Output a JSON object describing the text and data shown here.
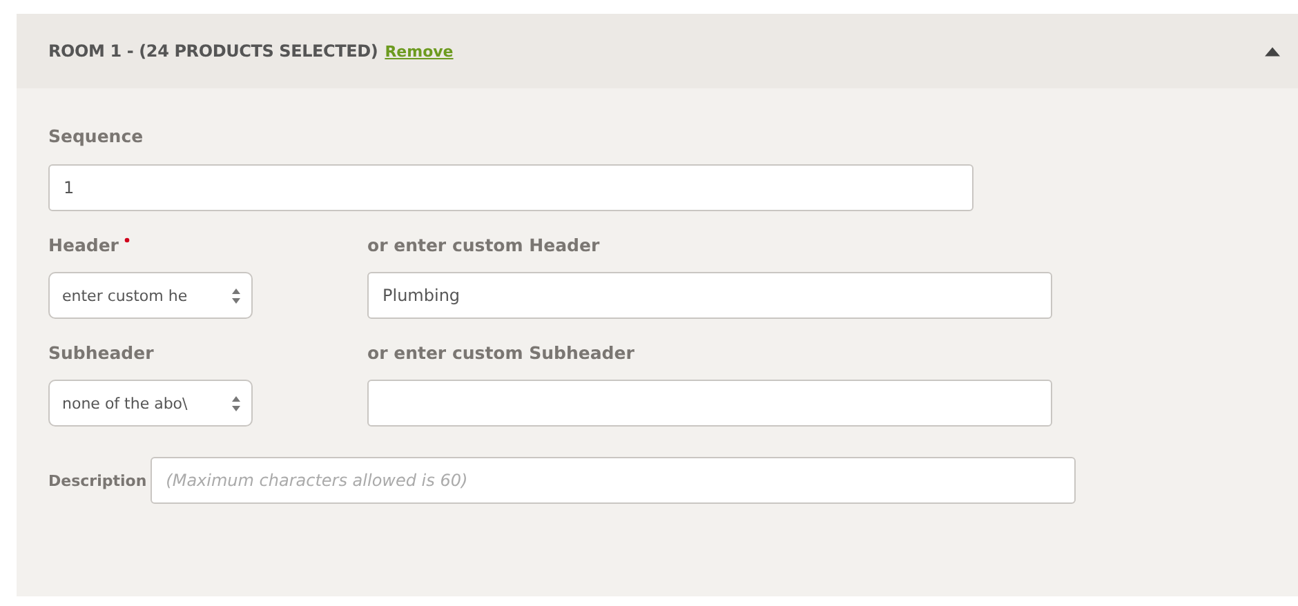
{
  "panel": {
    "title": "ROOM 1 - (24 PRODUCTS SELECTED)",
    "remove_link": "Remove",
    "expanded": true
  },
  "sequence": {
    "label": "Sequence",
    "value": "1"
  },
  "fields": [
    {
      "label": "Header",
      "required": true,
      "select_value": "enter custom he",
      "custom_label": "or enter custom Header",
      "custom_value": "Plumbing"
    },
    {
      "label": "Subheader",
      "required": false,
      "select_value": "none of the abo\\",
      "custom_label": "or enter custom Subheader"
    }
  ],
  "description": {
    "label": "Description",
    "placeholder": "(Maximum characters allowed is 60)"
  }
}
